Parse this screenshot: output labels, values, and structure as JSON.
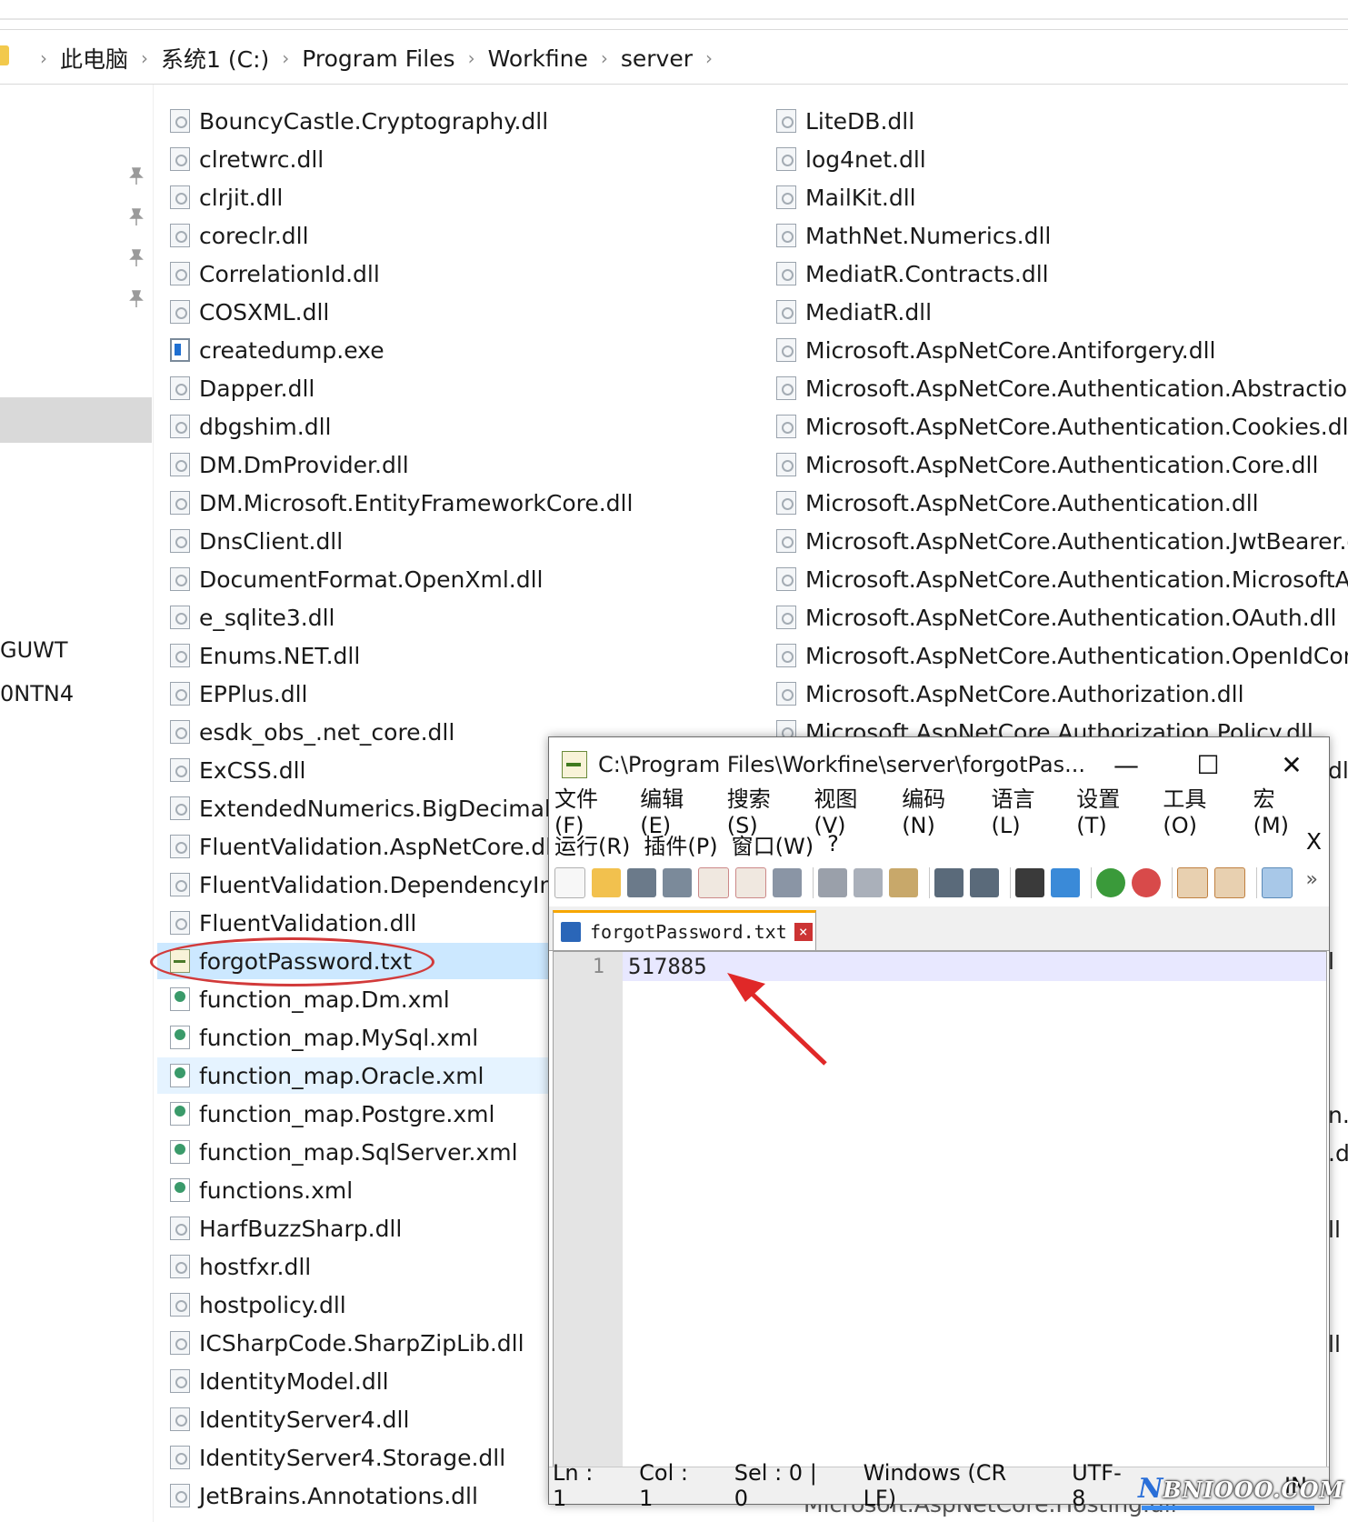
{
  "breadcrumb": [
    "此电脑",
    "系统1 (C:)",
    "Program Files",
    "Workfine",
    "server"
  ],
  "nav": {
    "partial_items": [
      "GUWT",
      "0NTN4"
    ]
  },
  "files_left": [
    {
      "name": "BouncyCastle.Cryptography.dll",
      "type": "dll"
    },
    {
      "name": "clretwrc.dll",
      "type": "dll"
    },
    {
      "name": "clrjit.dll",
      "type": "dll"
    },
    {
      "name": "coreclr.dll",
      "type": "dll"
    },
    {
      "name": "CorrelationId.dll",
      "type": "dll"
    },
    {
      "name": "COSXML.dll",
      "type": "dll"
    },
    {
      "name": "createdump.exe",
      "type": "exe"
    },
    {
      "name": "Dapper.dll",
      "type": "dll"
    },
    {
      "name": "dbgshim.dll",
      "type": "dll"
    },
    {
      "name": "DM.DmProvider.dll",
      "type": "dll"
    },
    {
      "name": "DM.Microsoft.EntityFrameworkCore.dll",
      "type": "dll"
    },
    {
      "name": "DnsClient.dll",
      "type": "dll"
    },
    {
      "name": "DocumentFormat.OpenXml.dll",
      "type": "dll"
    },
    {
      "name": "e_sqlite3.dll",
      "type": "dll"
    },
    {
      "name": "Enums.NET.dll",
      "type": "dll"
    },
    {
      "name": "EPPlus.dll",
      "type": "dll"
    },
    {
      "name": "esdk_obs_.net_core.dll",
      "type": "dll"
    },
    {
      "name": "ExCSS.dll",
      "type": "dll"
    },
    {
      "name": "ExtendedNumerics.BigDecimal.dll",
      "type": "dll"
    },
    {
      "name": "FluentValidation.AspNetCore.dll",
      "type": "dll"
    },
    {
      "name": "FluentValidation.DependencyInjec",
      "type": "dll"
    },
    {
      "name": "FluentValidation.dll",
      "type": "dll"
    },
    {
      "name": "forgotPassword.txt",
      "type": "txt"
    },
    {
      "name": "function_map.Dm.xml",
      "type": "xml"
    },
    {
      "name": "function_map.MySql.xml",
      "type": "xml"
    },
    {
      "name": "function_map.Oracle.xml",
      "type": "xml"
    },
    {
      "name": "function_map.Postgre.xml",
      "type": "xml"
    },
    {
      "name": "function_map.SqlServer.xml",
      "type": "xml"
    },
    {
      "name": "functions.xml",
      "type": "xml"
    },
    {
      "name": "HarfBuzzSharp.dll",
      "type": "dll"
    },
    {
      "name": "hostfxr.dll",
      "type": "dll"
    },
    {
      "name": "hostpolicy.dll",
      "type": "dll"
    },
    {
      "name": "ICSharpCode.SharpZipLib.dll",
      "type": "dll"
    },
    {
      "name": "IdentityModel.dll",
      "type": "dll"
    },
    {
      "name": "IdentityServer4.dll",
      "type": "dll"
    },
    {
      "name": "IdentityServer4.Storage.dll",
      "type": "dll"
    },
    {
      "name": "JetBrains.Annotations.dll",
      "type": "dll"
    }
  ],
  "files_right": [
    {
      "name": "LiteDB.dll",
      "type": "dll"
    },
    {
      "name": "log4net.dll",
      "type": "dll"
    },
    {
      "name": "MailKit.dll",
      "type": "dll"
    },
    {
      "name": "MathNet.Numerics.dll",
      "type": "dll"
    },
    {
      "name": "MediatR.Contracts.dll",
      "type": "dll"
    },
    {
      "name": "MediatR.dll",
      "type": "dll"
    },
    {
      "name": "Microsoft.AspNetCore.Antiforgery.dll",
      "type": "dll"
    },
    {
      "name": "Microsoft.AspNetCore.Authentication.Abstractions.d",
      "type": "dll"
    },
    {
      "name": "Microsoft.AspNetCore.Authentication.Cookies.dll",
      "type": "dll"
    },
    {
      "name": "Microsoft.AspNetCore.Authentication.Core.dll",
      "type": "dll"
    },
    {
      "name": "Microsoft.AspNetCore.Authentication.dll",
      "type": "dll"
    },
    {
      "name": "Microsoft.AspNetCore.Authentication.JwtBearer.dll",
      "type": "dll"
    },
    {
      "name": "Microsoft.AspNetCore.Authentication.MicrosoftAcco",
      "type": "dll"
    },
    {
      "name": "Microsoft.AspNetCore.Authentication.OAuth.dll",
      "type": "dll"
    },
    {
      "name": "Microsoft.AspNetCore.Authentication.OpenIdConne",
      "type": "dll"
    },
    {
      "name": "Microsoft.AspNetCore.Authorization.dll",
      "type": "dll"
    },
    {
      "name": "Microsoft.AspNetCore.Authorization.Policy.dll",
      "type": "dll"
    }
  ],
  "right_peeks": [
    "dl",
    "l",
    "n.c",
    ".d",
    "ll",
    "ll",
    "Microsoft.AspNetCore.Hosting.dll"
  ],
  "notepad": {
    "title": "C:\\Program Files\\Workfine\\server\\forgotPas...",
    "window_buttons": {
      "minimize": "—",
      "maximize": "☐",
      "close": "✕"
    },
    "menu_row1": [
      "文件(F)",
      "编辑(E)",
      "搜索(S)",
      "视图(V)",
      "编码(N)",
      "语言(L)",
      "设置(T)",
      "工具(O)",
      "宏(M)"
    ],
    "menu_row2": [
      "运行(R)",
      "插件(P)",
      "窗口(W)",
      "?"
    ],
    "menu_close": "X",
    "toolbar_more": "»",
    "tab": {
      "label": "forgotPassword.txt",
      "close": "×"
    },
    "editor": {
      "line_number": "1",
      "content": "517885"
    },
    "status": {
      "ln": "Ln : 1",
      "col": "Col : 1",
      "sel": "Sel : 0 | 0",
      "eol": "Windows (CR LF)",
      "encoding": "UTF-8",
      "ins": "IN"
    }
  },
  "watermark": {
    "n": "N",
    "rest": "BNIOOO.COM"
  },
  "colors": {
    "accent": "#f7a600",
    "annotation_red": "#d23a3a",
    "selected_row": "#cce8ff"
  }
}
